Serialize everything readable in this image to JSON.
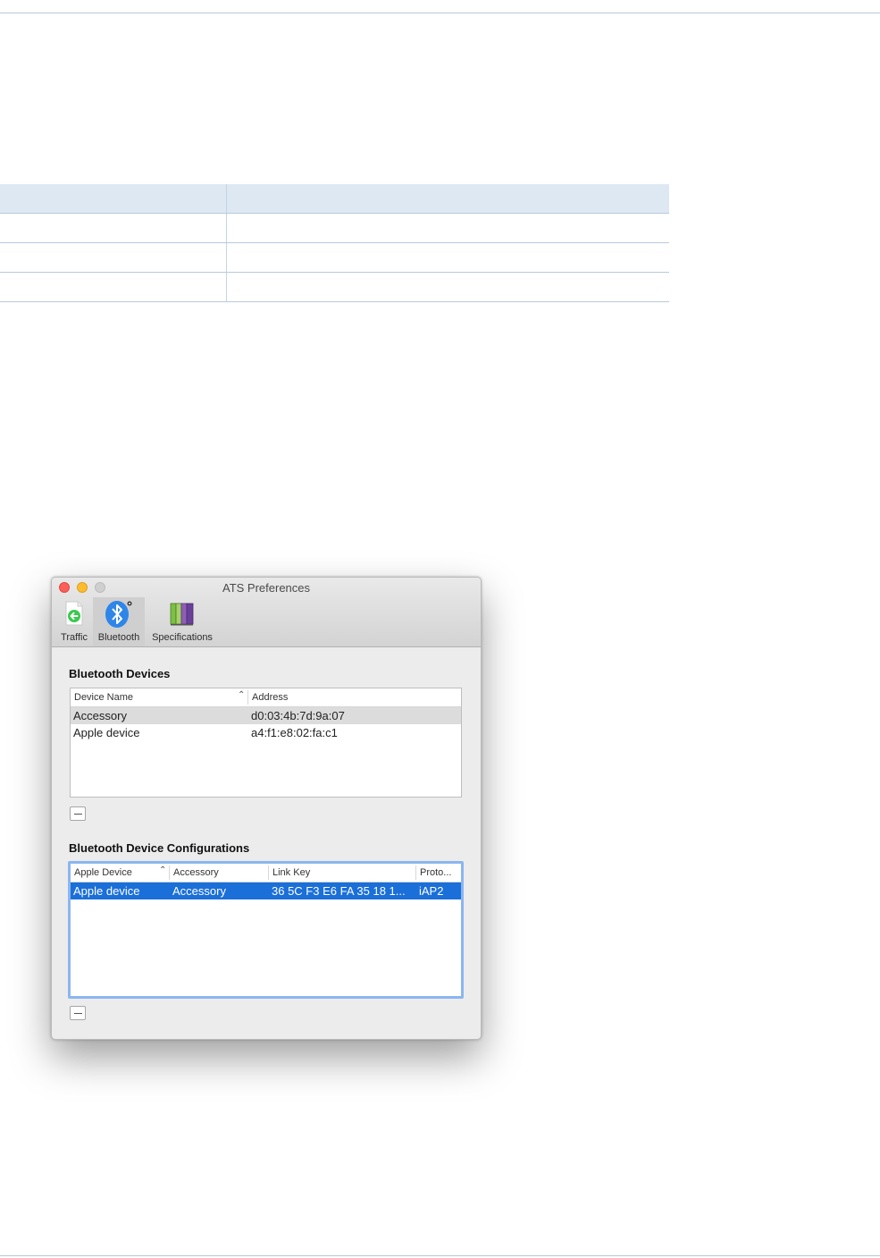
{
  "doc_table": {
    "rows": [
      [
        "",
        ""
      ],
      [
        "",
        ""
      ],
      [
        "",
        ""
      ],
      [
        "",
        ""
      ]
    ]
  },
  "window": {
    "title": "ATS Preferences",
    "toolbar": [
      {
        "label": "Traffic",
        "icon": "traffic-icon"
      },
      {
        "label": "Bluetooth",
        "icon": "bluetooth-icon",
        "selected": true
      },
      {
        "label": "Specifications",
        "icon": "specifications-icon"
      }
    ],
    "devices": {
      "title": "Bluetooth Devices",
      "columns": [
        "Device Name",
        "Address"
      ],
      "rows": [
        {
          "name": "Accessory",
          "address": "d0:03:4b:7d:9a:07"
        },
        {
          "name": "Apple device",
          "address": "a4:f1:e8:02:fa:c1"
        }
      ],
      "remove_label": "—"
    },
    "configs": {
      "title": "Bluetooth Device Configurations",
      "columns": [
        "Apple Device",
        "Accessory",
        "Link Key",
        "Proto..."
      ],
      "rows": [
        {
          "apple_device": "Apple device",
          "accessory": "Accessory",
          "link_key": "36 5C F3 E6 FA 35 18 1...",
          "protocol": "iAP2"
        }
      ],
      "remove_label": "—"
    }
  },
  "colors": {
    "selection_blue": "#1b6fd8",
    "close": "#fc5f57",
    "minimize": "#fdbc2e",
    "table_header_bg": "#dde8f3"
  }
}
